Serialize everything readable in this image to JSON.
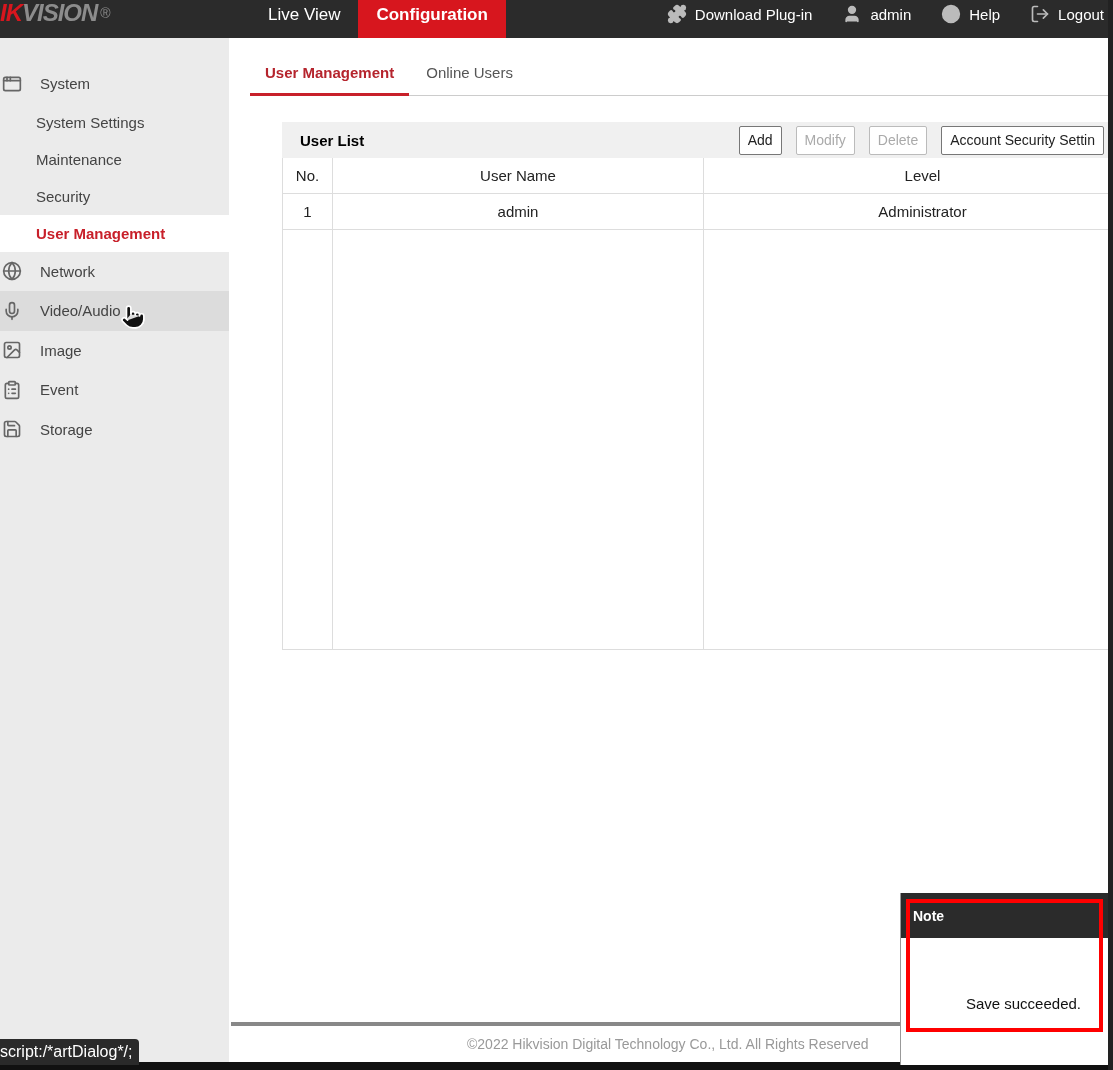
{
  "header": {
    "logo": {
      "accent": "IK",
      "rest": "VISION",
      "mark": "®"
    },
    "nav": [
      {
        "label": "Live View",
        "selected": false
      },
      {
        "label": "Configuration",
        "selected": true
      }
    ],
    "links": [
      "Download Plug-in",
      "admin",
      "Help",
      "Logout"
    ]
  },
  "sidebar": {
    "items": [
      {
        "kind": "group",
        "label": "System",
        "selected": false,
        "hovered": false
      },
      {
        "kind": "sub",
        "label": "System Settings",
        "selected": false,
        "hovered": false
      },
      {
        "kind": "sub",
        "label": "Maintenance",
        "selected": false,
        "hovered": false
      },
      {
        "kind": "sub",
        "label": "Security",
        "selected": false,
        "hovered": false
      },
      {
        "kind": "sub",
        "label": "User Management",
        "selected": true,
        "hovered": false
      },
      {
        "kind": "group",
        "label": "Network",
        "selected": false,
        "hovered": false
      },
      {
        "kind": "group",
        "label": "Video/Audio",
        "selected": false,
        "hovered": true
      },
      {
        "kind": "group",
        "label": "Image",
        "selected": false,
        "hovered": false
      },
      {
        "kind": "group",
        "label": "Event",
        "selected": false,
        "hovered": false
      },
      {
        "kind": "group",
        "label": "Storage",
        "selected": false,
        "hovered": false
      }
    ]
  },
  "tabs": [
    {
      "label": "User Management",
      "selected": true
    },
    {
      "label": "Online Users",
      "selected": false
    }
  ],
  "user_list": {
    "title": "User List",
    "buttons": [
      {
        "label": "Add",
        "disabled": false
      },
      {
        "label": "Modify",
        "disabled": true
      },
      {
        "label": "Delete",
        "disabled": true
      },
      {
        "label": "Account Security Settin",
        "disabled": false
      }
    ],
    "columns": [
      "No.",
      "User Name",
      "Level"
    ],
    "rows": [
      [
        "1",
        "admin",
        "Administrator"
      ]
    ]
  },
  "footer": "©2022 Hikvision Digital Technology Co., Ltd. All Rights Reserved",
  "status_tip": "script:/*artDialog*/;",
  "dialog": {
    "title": "Note",
    "message": "Save succeeded."
  }
}
